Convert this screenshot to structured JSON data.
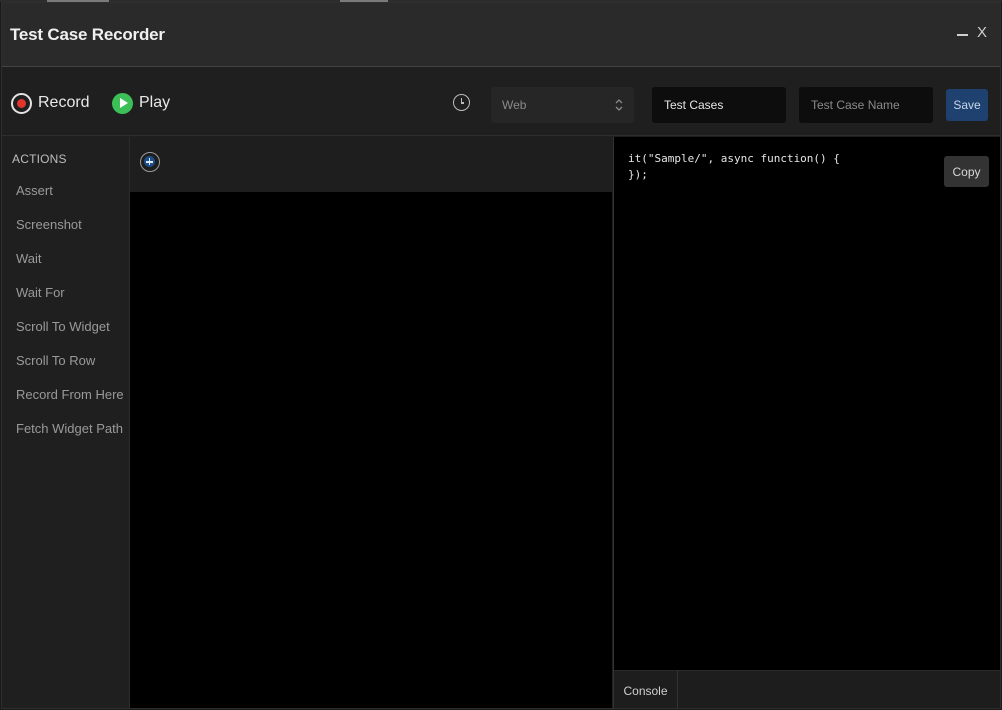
{
  "window": {
    "title": "Test Case Recorder",
    "close_label": "X"
  },
  "toolbar": {
    "record_label": "Record",
    "play_label": "Play",
    "platform_value": "Web",
    "test_cases_value": "Test Cases",
    "test_case_name_placeholder": "Test Case Name",
    "save_label": "Save"
  },
  "sidebar": {
    "heading": "ACTIONS",
    "items": [
      {
        "label": "Assert"
      },
      {
        "label": "Screenshot"
      },
      {
        "label": "Wait"
      },
      {
        "label": "Wait For"
      },
      {
        "label": "Scroll To Widget"
      },
      {
        "label": "Scroll To Row"
      },
      {
        "label": "Record From Here"
      },
      {
        "label": "Fetch Widget Path"
      }
    ]
  },
  "code_panel": {
    "code": "it(\"Sample/\", async function() {\n});",
    "copy_label": "Copy",
    "console_tab": "Console"
  },
  "colors": {
    "record_red": "#e0352f",
    "play_green": "#3dbf57",
    "save_blue": "#1f4170",
    "add_blue": "#1b4e8a"
  },
  "icons": {
    "record": "record-icon",
    "play": "play-icon",
    "history": "clock-icon",
    "select_arrows": "chevron-up-down-icon",
    "add_step": "plus-circle-icon",
    "minimize": "minimize-icon",
    "close": "close-icon"
  }
}
